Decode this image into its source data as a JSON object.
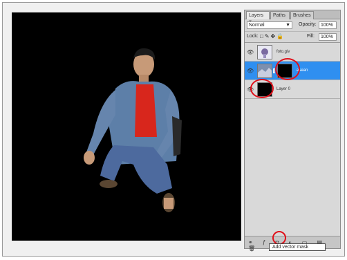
{
  "panel": {
    "tabs": [
      {
        "label": "Layers ×"
      },
      {
        "label": "Paths"
      },
      {
        "label": "Brushes"
      }
    ],
    "blend_mode": "Normal",
    "opacity_label": "Opacity:",
    "opacity_value": "100%",
    "lock_label": "Lock:",
    "fill_label": "Fill:",
    "fill_value": "100%",
    "layers": [
      {
        "name": "foto.giv"
      },
      {
        "name": "asean"
      },
      {
        "name": "Layer 0"
      }
    ]
  },
  "tooltip": "Add vector mask",
  "colors": {
    "selected_layer": "#2f8ff0",
    "highlight_ring": "#e0101a"
  }
}
